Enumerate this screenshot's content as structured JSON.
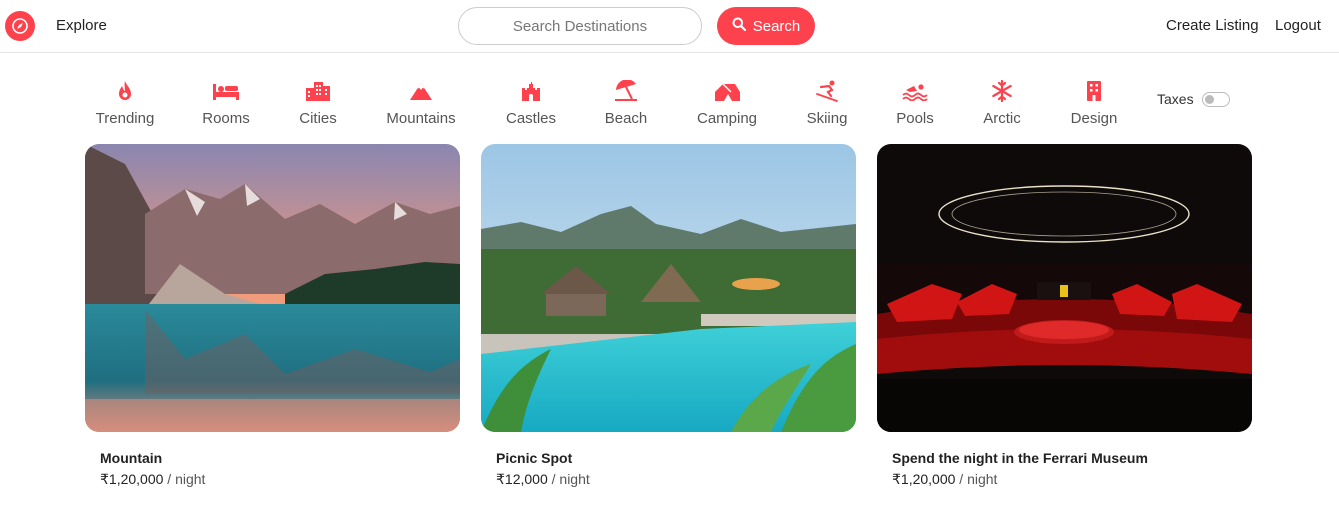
{
  "brand": {
    "accent_color": "#fe424d",
    "logo_icon": "compass-icon"
  },
  "nav": {
    "explore": "Explore",
    "search_placeholder": "Search Destinations",
    "search_button": "Search",
    "create_listing": "Create Listing",
    "logout": "Logout"
  },
  "filters": [
    {
      "label": "Trending",
      "icon": "fire-icon"
    },
    {
      "label": "Rooms",
      "icon": "bed-icon"
    },
    {
      "label": "Cities",
      "icon": "city-icon"
    },
    {
      "label": "Mountains",
      "icon": "mountain-icon"
    },
    {
      "label": "Castles",
      "icon": "castle-icon"
    },
    {
      "label": "Beach",
      "icon": "umbrella-beach-icon"
    },
    {
      "label": "Camping",
      "icon": "campground-icon"
    },
    {
      "label": "Skiing",
      "icon": "skiing-icon"
    },
    {
      "label": "Pools",
      "icon": "swimmer-icon"
    },
    {
      "label": "Arctic",
      "icon": "snowflake-icon"
    },
    {
      "label": "Design",
      "icon": "building-icon"
    }
  ],
  "taxes": {
    "label": "Taxes",
    "enabled": false
  },
  "listings": [
    {
      "title": "Mountain",
      "price": "₹1,20,000",
      "per": " / night"
    },
    {
      "title": "Picnic Spot",
      "price": "₹12,000",
      "per": " / night"
    },
    {
      "title": "Spend the night in the Ferrari Museum",
      "price": "₹1,20,000",
      "per": " / night"
    }
  ]
}
